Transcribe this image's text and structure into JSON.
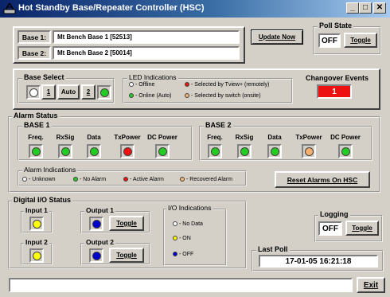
{
  "window": {
    "title": "Hot Standby Base/Repeater Controller (HSC)",
    "min_label": "_",
    "max_label": "□",
    "close_label": "✕"
  },
  "bases": {
    "base1_label": "Base 1:",
    "base1_value": "Mt Bench Base 1 [52513]",
    "base2_label": "Base 2:",
    "base2_value": "Mt Bench Base 2 [50014]"
  },
  "update_button": "Update Now",
  "poll_state": {
    "title": "Poll State",
    "value": "OFF",
    "toggle_label": "Toggle"
  },
  "base_select": {
    "title": "Base Select",
    "btn_1": "1",
    "btn_auto": "Auto",
    "btn_2": "2",
    "left_led_color": "#ffffff",
    "right_led_color": "#22cc22"
  },
  "led_indications": {
    "title": "LED Indications",
    "items": [
      {
        "label": "- Offline",
        "color": "#ffffff"
      },
      {
        "label": "- Selected by Tview+ (remotely)",
        "color": "#ee1111"
      },
      {
        "label": "- Online (Auto)",
        "color": "#22cc22"
      },
      {
        "label": "- Selected by switch (onsite)",
        "color": "#f5b070"
      }
    ]
  },
  "changeover": {
    "title": "Changover Events",
    "value": "1",
    "color": "#ee1111"
  },
  "alarm_status": {
    "title": "Alarm Status",
    "columns": [
      "Freq.",
      "RxSig",
      "Data",
      "TxPower",
      "DC Power"
    ],
    "base1": {
      "title": "BASE 1",
      "colors": [
        "#22cc22",
        "#22cc22",
        "#22cc22",
        "#ee1111",
        "#22cc22"
      ]
    },
    "base2": {
      "title": "BASE 2",
      "colors": [
        "#22cc22",
        "#22cc22",
        "#22cc22",
        "#f5b070",
        "#22cc22"
      ]
    },
    "indications_title": "Alarm Indications",
    "indications": [
      {
        "label": "- Unknown",
        "color": "#ffffff"
      },
      {
        "label": "- No Alarm",
        "color": "#22cc22"
      },
      {
        "label": "- Active Alarm",
        "color": "#ee1111"
      },
      {
        "label": "- Recovered Alarm",
        "color": "#f5b070"
      }
    ],
    "reset_button": "Reset Alarms On HSC"
  },
  "digital_io": {
    "title": "Digital I/O Status",
    "input1": "Input 1",
    "input2": "Input 2",
    "output1": "Output 1",
    "output2": "Output 2",
    "toggle_label": "Toggle",
    "input1_color": "#ffff00",
    "input2_color": "#ffff00",
    "output1_color": "#0000cc",
    "output2_color": "#0000cc",
    "indications_title": "I/O Indications",
    "indications": [
      {
        "label": "- No Data",
        "color": "#ffffff"
      },
      {
        "label": "- ON",
        "color": "#ffff00"
      },
      {
        "label": "- OFF",
        "color": "#0000cc"
      }
    ]
  },
  "logging": {
    "title": "Logging",
    "value": "OFF",
    "toggle_label": "Toggle"
  },
  "last_poll": {
    "title": "Last Poll",
    "value": "17-01-05  16:21:18"
  },
  "status_bar": {
    "text": "",
    "exit_label": "Exit"
  }
}
